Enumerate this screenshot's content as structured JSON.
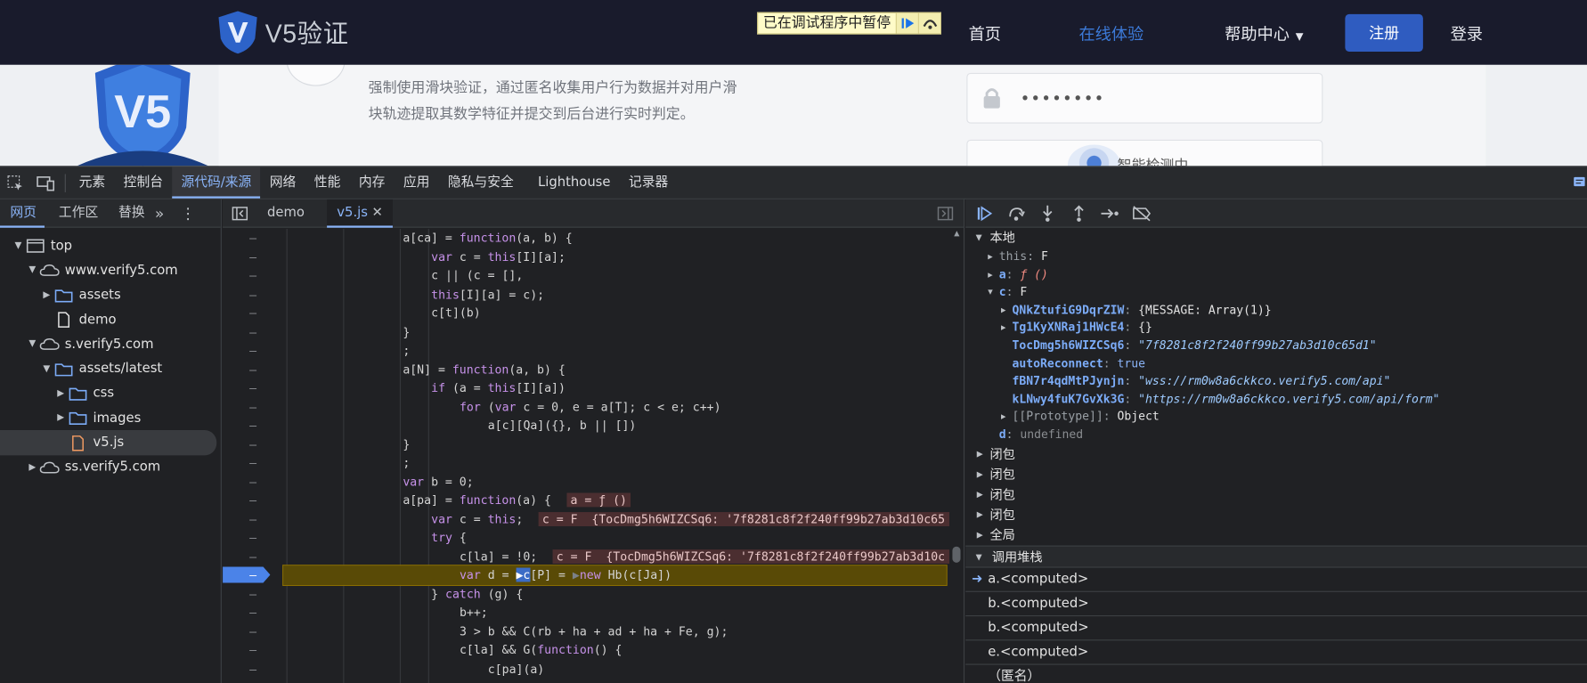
{
  "site": {
    "logo_text": "V5验证",
    "pause_label": "已在调试程序中暂停",
    "nav": [
      "首页",
      "在线体验",
      "帮助中心",
      "注册",
      "登录"
    ],
    "desc": "强制使用滑块验证，通过匿名收集用户行为数据并对用户滑块轨迹提取其数学特征并提交到后台进行实时判定。",
    "password_mask": "••••••••",
    "smart_label": "智能检测中"
  },
  "devtools": {
    "tabs": [
      "元素",
      "控制台",
      "源代码/来源",
      "网络",
      "性能",
      "内存",
      "应用",
      "隐私与安全",
      "Lighthouse",
      "记录器"
    ],
    "active_tab": "源代码/来源",
    "nav_tabs": [
      "网页",
      "工作区",
      "替换"
    ],
    "tree": [
      "top",
      "www.verify5.com",
      "assets",
      "demo",
      "s.verify5.com",
      "assets/latest",
      "css",
      "images",
      "v5.js",
      "ss.verify5.com"
    ],
    "editor_tabs": [
      "demo",
      "v5.js"
    ],
    "code_lines": [
      "a[ca] = function(a, b) {",
      "var c = this[I][a];",
      "c || (c = [],",
      "this[I][a] = c);",
      "c[t](b)",
      "}",
      ";",
      "a[N] = function(a, b) {",
      "if (a = this[I][a])",
      "for (var c = 0, e = a[T]; c < e; c++)",
      "a[c][Qa]({}, b || [])",
      "}",
      ";",
      "var b = 0;",
      "a[pa] = function(a) {",
      "var c = this;",
      "try {",
      "c[la] = !0;",
      "var d = c[P] = new Hb(c[Ja])",
      "} catch (g) {",
      "b++;",
      "3 > b && C(rb + ha + ad + ha + Fe, g);",
      "c[la] && G(function() {",
      "c[pa](a)"
    ],
    "gutter_mark": "–",
    "inline_values": {
      "l15": "a = ƒ ()",
      "l16": "c = F  {TocDmg5h6WIZCSq6: '7f8281c8f2f240ff99b27ab3d10c65",
      "l18": "c = F  {TocDmg5h6WIZCSq6: '7f8281c8f2f240ff99b27ab3d10c"
    },
    "scope": {
      "local_label": "本地",
      "this_key": "this",
      "this_val": "F",
      "a_key": "a",
      "a_val": "ƒ ()",
      "c_key": "c",
      "c_val": "F",
      "c_props": [
        {
          "k": "QNkZtufiG9DqrZIW",
          "v": "{MESSAGE: Array(1)}"
        },
        {
          "k": "Tg1KyXNRaj1HWcE4",
          "v": "{}"
        },
        {
          "k": "TocDmg5h6WIZCSq6",
          "v": "\"7f8281c8f2f240ff99b27ab3d10c65d1\""
        },
        {
          "k": "autoReconnect",
          "v": "true"
        },
        {
          "k": "fBN7r4qdMtPJynjn",
          "v": "\"wss://rm0w8a6ckkco.verify5.com/api\""
        },
        {
          "k": "kLNwy4fuK7GvXk3G",
          "v": "\"https://rm0w8a6ckkco.verify5.com/api/form\""
        },
        {
          "k": "[[Prototype]]",
          "v": "Object"
        }
      ],
      "d_key": "d",
      "d_val": "undefined",
      "closures": [
        "闭包",
        "闭包",
        "闭包",
        "闭包"
      ],
      "global_label": "全局"
    },
    "callstack_label": "调用堆栈",
    "callstack": [
      "a.<computed>",
      "b.<computed>",
      "b.<computed>",
      "e.<computed>",
      "（匿名）"
    ]
  },
  "colors": {
    "accent": "#8ab4f8",
    "brand": "#2f5cc0",
    "nav_bg": "#191b2c"
  }
}
